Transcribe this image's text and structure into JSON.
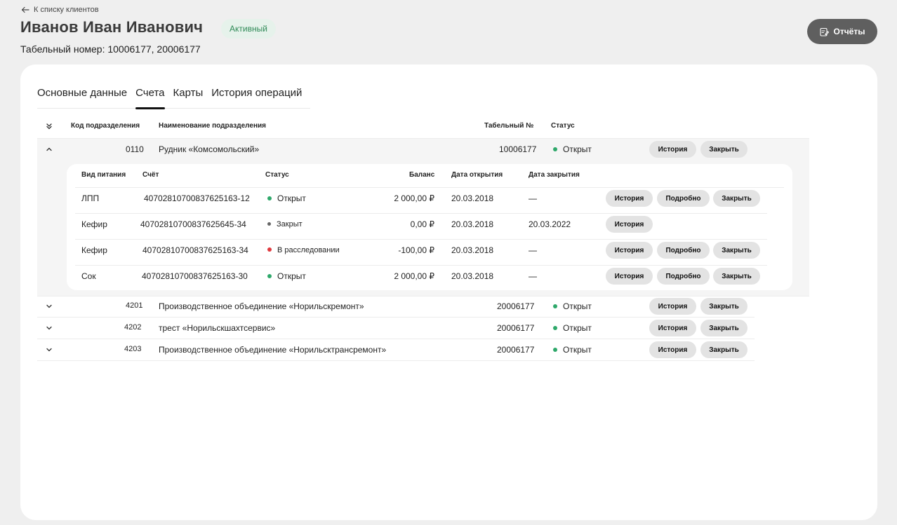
{
  "header": {
    "back_label": "К списку клиентов",
    "client_name": "Иванов Иван Иванович",
    "status": "Активный",
    "tabnum_label": "Табельный номер: 10006177, 20006177",
    "reports_label": "Отчёты"
  },
  "tabs": [
    {
      "label": "Основные данные"
    },
    {
      "label": "Счета"
    },
    {
      "label": "Карты"
    },
    {
      "label": "История операций"
    }
  ],
  "table": {
    "headers": {
      "code": "Код подразделения",
      "name": "Наименование подразделения",
      "tabnum": "Табельный №",
      "status": "Статус"
    },
    "rows": [
      {
        "code": "0110",
        "name": "Рудник «Комсомольский»",
        "tabnum": "10006177",
        "status": "Открыт",
        "btn_history": "История",
        "btn_close": "Закрыть"
      },
      {
        "code": "4201",
        "name": "Производственное объединение «Норильскремонт»",
        "tabnum": "20006177",
        "status": "Открыт",
        "btn_history": "История",
        "btn_close": "Закрыть"
      },
      {
        "code": "4202",
        "name": "трест «Норильскшахтсервис»",
        "tabnum": "20006177",
        "status": "Открыт",
        "btn_history": "История",
        "btn_close": "Закрыть"
      },
      {
        "code": "4203",
        "name": "Производственное объединение «Норильсктрансремонт»",
        "tabnum": "20006177",
        "status": "Открыт",
        "btn_history": "История",
        "btn_close": "Закрыть"
      }
    ]
  },
  "accounts": {
    "headers": {
      "type": "Вид питания",
      "account": "Счёт",
      "status": "Статус",
      "balance": "Баланс",
      "opened": "Дата открытия",
      "closed": "Дата закрытия"
    },
    "rows": [
      {
        "type": "ЛПП",
        "account": "40702810700837625163-12",
        "status": "Открыт",
        "balance": "2 000,00 ₽",
        "opened": "20.03.2018",
        "closed": "—",
        "btn_history": "История",
        "btn_details": "Подробно",
        "btn_close": "Закрыть"
      },
      {
        "type": "Кефир",
        "account": "40702810700837625645-34",
        "status": "Закрыт",
        "balance": "0,00 ₽",
        "opened": "20.03.2018",
        "closed": "20.03.2022",
        "btn_history": "История"
      },
      {
        "type": "Кефир",
        "account": "40702810700837625163-34",
        "status": "В расследовании",
        "balance": "-100,00 ₽",
        "opened": "20.03.2018",
        "closed": "—",
        "btn_history": "История",
        "btn_details": "Подробно",
        "btn_close": "Закрыть"
      },
      {
        "type": "Сок",
        "account": "40702810700837625163-30",
        "status": "Открыт",
        "balance": "2 000,00 ₽",
        "opened": "20.03.2018",
        "closed": "—",
        "btn_history": "История",
        "btn_details": "Подробно",
        "btn_close": "Закрыть"
      }
    ]
  },
  "colors": {
    "open": "#2ea86a",
    "closed": "#666666",
    "investigation": "#e0393e",
    "reports_button": "#5f5f5f",
    "active_badge_bg": "#e6f2eb"
  }
}
